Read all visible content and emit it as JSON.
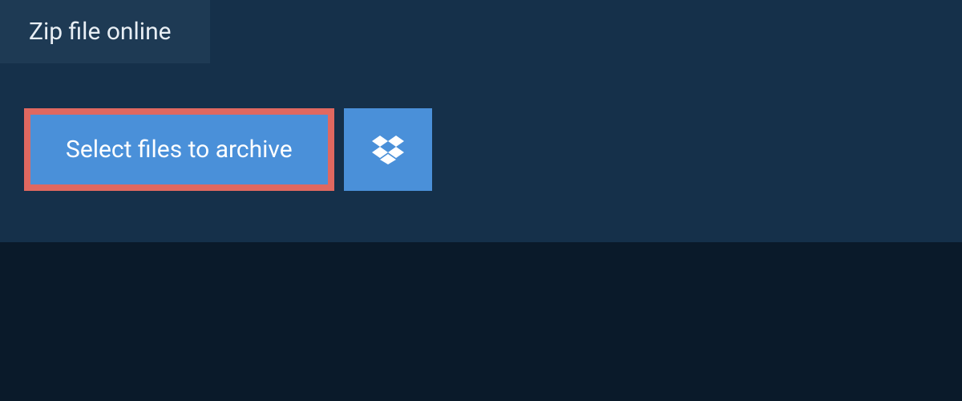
{
  "tab": {
    "label": "Zip file online"
  },
  "actions": {
    "select_files_label": "Select files to archive"
  },
  "colors": {
    "background": "#0a1a2a",
    "panel": "#15304a",
    "tab": "#1e3a54",
    "button": "#4a90d9",
    "highlight_border": "#e06860",
    "text_light": "#ffffff"
  }
}
